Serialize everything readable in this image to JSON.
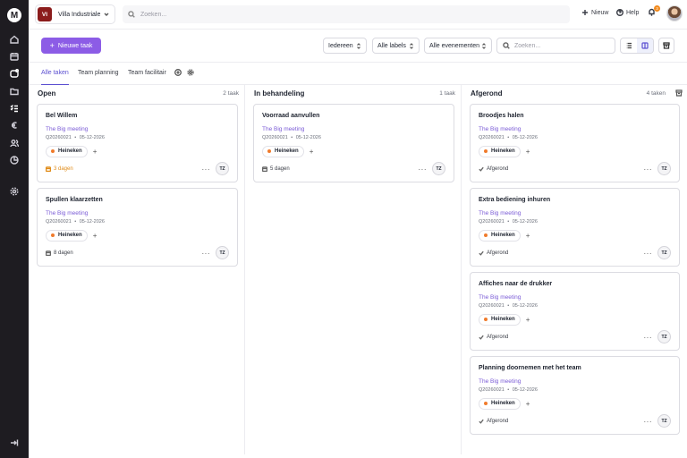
{
  "brand": {
    "logo_letter": "M",
    "accent": "#8c5ce6",
    "tag_dot": "#f07b2c"
  },
  "workspace": {
    "initials": "VI",
    "name": "Villa Industriale"
  },
  "global_search": {
    "placeholder": "Zoeken..."
  },
  "topbar": {
    "new_label": "Nieuw",
    "help_label": "Help",
    "notifications_count": "3"
  },
  "toolbar": {
    "new_task_label": "Nieuwe taak",
    "filter_people": "Iedereen",
    "filter_labels": "Alle labels",
    "filter_events": "Alle evenementen",
    "search_placeholder": "Zoeken..."
  },
  "tabs": [
    "Alle taken",
    "Team planning",
    "Team facilitair"
  ],
  "columns": [
    {
      "title": "Open",
      "count": "2 taak",
      "cards": [
        {
          "title": "Bel Willem",
          "event": "The Big meeting",
          "code": "Q20260021",
          "date": "05-12-2026",
          "tag": "Heineken",
          "due": "3 dagen",
          "assignee": "TZ"
        },
        {
          "title": "Spullen klaarzetten",
          "event": "The Big meeting",
          "code": "Q20260021",
          "date": "05-12-2026",
          "tag": "Heineken",
          "due": "8 dagen",
          "assignee": "TZ"
        }
      ]
    },
    {
      "title": "In behandeling",
      "count": "1 taak",
      "cards": [
        {
          "title": "Voorraad aanvullen",
          "event": "The Big meeting",
          "code": "Q20260021",
          "date": "05-12-2026",
          "tag": "Heineken",
          "due": "5 dagen",
          "assignee": "TZ"
        }
      ]
    },
    {
      "title": "Afgerond",
      "count": "4 taken",
      "cards": [
        {
          "title": "Broodjes halen",
          "event": "The Big meeting",
          "code": "Q20260021",
          "date": "05-12-2026",
          "tag": "Heineken",
          "due": "Afgerond",
          "assignee": "TZ"
        },
        {
          "title": "Extra bediening inhuren",
          "event": "The Big meeting",
          "code": "Q20260021",
          "date": "05-12-2026",
          "tag": "Heineken",
          "due": "Afgerond",
          "assignee": "TZ"
        },
        {
          "title": "Affiches naar de drukker",
          "event": "The Big meeting",
          "code": "Q20260021",
          "date": "05-12-2026",
          "tag": "Heineken",
          "due": "Afgerond",
          "assignee": "TZ"
        },
        {
          "title": "Planning doornemen met het team",
          "event": "The Big meeting",
          "code": "Q20260021",
          "date": "05-12-2026",
          "tag": "Heineken",
          "due": "Afgerond",
          "assignee": "TZ"
        }
      ]
    }
  ],
  "meta_separator": "•",
  "more_glyph": "···",
  "add_glyph": "+"
}
